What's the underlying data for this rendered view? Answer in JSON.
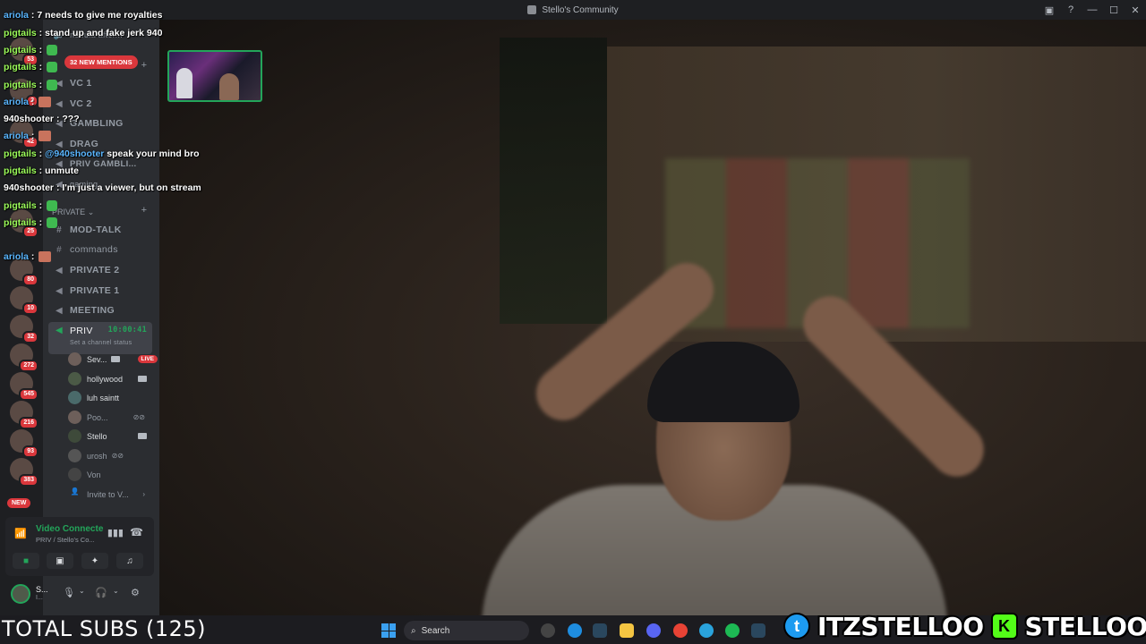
{
  "window": {
    "title": "Stello's Community"
  },
  "server_rail": {
    "badges": [
      "53",
      "2",
      "42",
      "25",
      "80",
      "10",
      "32",
      "272",
      "545",
      "216",
      "93",
      "383"
    ],
    "new_label": "NEW"
  },
  "sidebar": {
    "top_channel": "nebula after...",
    "mentions_pill": "32 NEW MENTIONS",
    "channels_top": [
      {
        "name": "VC 1"
      },
      {
        "name": "VC 2"
      },
      {
        "name": "GAMBLING"
      },
      {
        "name": "DRAG"
      },
      {
        "name": "PRIV GAMBLI..."
      },
      {
        "name": "gaming"
      }
    ],
    "private_category": "PRIVATE",
    "channels_private": [
      {
        "name": "MOD-TALK"
      },
      {
        "name": "commands"
      },
      {
        "name": "PRIVATE 2"
      },
      {
        "name": "PRIVATE 1"
      },
      {
        "name": "MEETING"
      }
    ],
    "active_channel": {
      "name": "PRIV",
      "timer": "10:00:41",
      "status": "Set a channel status"
    },
    "members": [
      {
        "name": "Sev...",
        "live": "LIVE"
      },
      {
        "name": "hollywood"
      },
      {
        "name": "luh saintt"
      },
      {
        "name": "Poo..."
      },
      {
        "name": "Stello"
      },
      {
        "name": "urosh"
      },
      {
        "name": "Von"
      }
    ],
    "invite": "Invite to V..."
  },
  "voice_panel": {
    "title": "Video Connecte",
    "subtitle": "PRIV / Stello's Co..."
  },
  "user_bar": {
    "name": "S...",
    "status": "I..."
  },
  "chat": [
    {
      "user": "ariola",
      "text": "7 needs to give me royalties",
      "color": "blue"
    },
    {
      "user": "pigtails",
      "text": "stand up and fake jerk 940",
      "color": "green"
    },
    {
      "user": "pigtails",
      "text": "",
      "color": "green"
    },
    {
      "user": "pigtails",
      "text": "",
      "color": "green"
    },
    {
      "user": "pigtails",
      "text": "",
      "color": "green"
    },
    {
      "user": "ariola",
      "text": "",
      "color": "blue"
    },
    {
      "user": "940shooter",
      "text": "???",
      "color": "white"
    },
    {
      "user": "ariola",
      "text": "",
      "color": "blue"
    },
    {
      "user": "pigtails",
      "mention": "@940shooter",
      "text": "speak your mind bro",
      "color": "green"
    },
    {
      "user": "pigtails",
      "text": "unmute",
      "color": "green"
    },
    {
      "user": "940shooter",
      "text": "I'm just a viewer, but on stream",
      "color": "white"
    },
    {
      "user": "pigtails",
      "text": "",
      "color": "green"
    },
    {
      "user": "pigtails",
      "text": "",
      "color": "green"
    },
    {
      "user": "ariola",
      "text": "",
      "color": "blue"
    }
  ],
  "overlay": {
    "total_subs": "TOTAL SUBS (125)",
    "twitter_handle": "ITZSTELLOO",
    "kick_handle": "STELLOOO",
    "kick_letter": "K"
  },
  "taskbar": {
    "search_label": "Search"
  },
  "colors": {
    "accent_green": "#23a55a",
    "alert_red": "#da373c",
    "twitter_blue": "#1d9bf0",
    "kick_green": "#53fc18"
  }
}
